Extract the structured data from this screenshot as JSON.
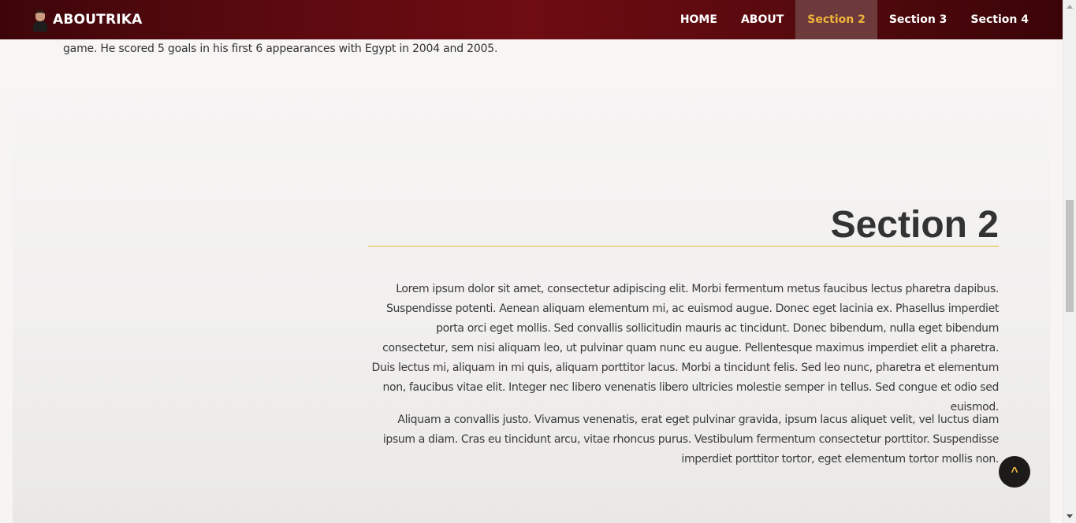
{
  "brand": {
    "name": "ABOUTRIKA",
    "avatar_icon": "player-portrait-icon"
  },
  "nav": {
    "items": [
      {
        "label": "HOME",
        "active": false
      },
      {
        "label": "ABOUT",
        "active": false
      },
      {
        "label": "Section 2",
        "active": true
      },
      {
        "label": "Section 3",
        "active": false
      },
      {
        "label": "Section 4",
        "active": false
      }
    ]
  },
  "previous_section": {
    "text_tail": "game. He scored 5 goals in his first 6 appearances with Egypt in 2004 and 2005."
  },
  "section2": {
    "title": "Section 2",
    "paragraphs": [
      "Lorem ipsum dolor sit amet, consectetur adipiscing elit. Morbi fermentum metus faucibus lectus pharetra dapibus. Suspendisse potenti. Aenean aliquam elementum mi, ac euismod augue. Donec eget lacinia ex. Phasellus imperdiet porta orci eget mollis. Sed convallis sollicitudin mauris ac tincidunt. Donec bibendum, nulla eget bibendum consectetur, sem nisi aliquam leo, ut pulvinar quam nunc eu augue. Pellentesque maximus imperdiet elit a pharetra. Duis lectus mi, aliquam in mi quis, aliquam porttitor lacus. Morbi a tincidunt felis. Sed leo nunc, pharetra et elementum non, faucibus vitae elit. Integer nec libero venenatis libero ultricies molestie semper in tellus. Sed congue et odio sed euismod.",
      "Aliquam a convallis justo. Vivamus venenatis, erat eget pulvinar gravida, ipsum lacus aliquet velit, vel luctus diam ipsum a diam. Cras eu tincidunt arcu, vitae rhoncus purus. Vestibulum fermentum consectetur porttitor. Suspendisse imperdiet porttitor tortor, eget elementum tortor mollis non."
    ]
  },
  "scroll_top": {
    "label": "^"
  },
  "colors": {
    "nav_bg": "#5a0a0f",
    "accent": "#f1b43a",
    "title_text": "#333333",
    "body_text": "#3a3a3a"
  }
}
